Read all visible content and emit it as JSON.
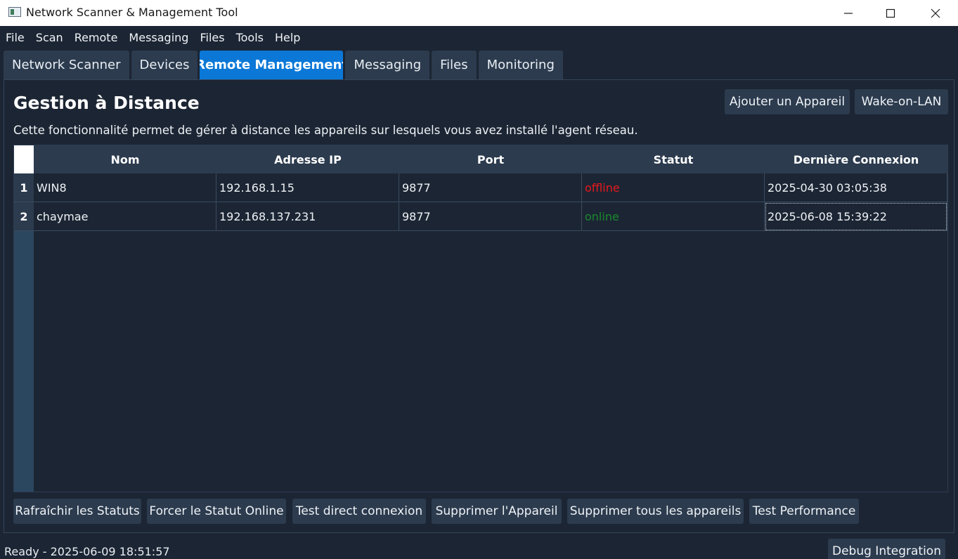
{
  "window": {
    "title": "Network Scanner & Management Tool"
  },
  "menu": [
    "File",
    "Scan",
    "Remote",
    "Messaging",
    "Files",
    "Tools",
    "Help"
  ],
  "tabs": [
    {
      "label": "Network Scanner"
    },
    {
      "label": "Devices"
    },
    {
      "label": "Remote Management",
      "active": true
    },
    {
      "label": "Messaging"
    },
    {
      "label": "Files"
    },
    {
      "label": "Monitoring"
    }
  ],
  "page": {
    "title": "Gestion à Distance",
    "description": "Cette fonctionnalité permet de gérer à distance les appareils sur lesquels vous avez installé l'agent réseau.",
    "add_button": "Ajouter un Appareil",
    "wol_button": "Wake-on-LAN"
  },
  "table": {
    "columns": [
      "Nom",
      "Adresse IP",
      "Port",
      "Statut",
      "Dernière Connexion"
    ],
    "rows": [
      {
        "num": "1",
        "cells": [
          "WIN8",
          "192.168.1.15",
          "9877",
          "offline",
          "2025-04-30 03:05:38"
        ]
      },
      {
        "num": "2",
        "cells": [
          "chaymae",
          "192.168.137.231",
          "9877",
          "online",
          "2025-06-08 15:39:22"
        ]
      }
    ]
  },
  "actions": [
    "Rafraîchir les Statuts",
    "Forcer le Statut Online",
    "Test direct connexion",
    "Supprimer l'Appareil",
    "Supprimer tous les appareils",
    "Test Performance"
  ],
  "statusbar": {
    "text": "Ready - 2025-06-09 18:51:57",
    "debug_button": "Debug Integration"
  },
  "colors": {
    "background": "#1c2533",
    "accent": "#0b78d8",
    "offline": "#e8191d",
    "online": "#1a8a2e"
  }
}
